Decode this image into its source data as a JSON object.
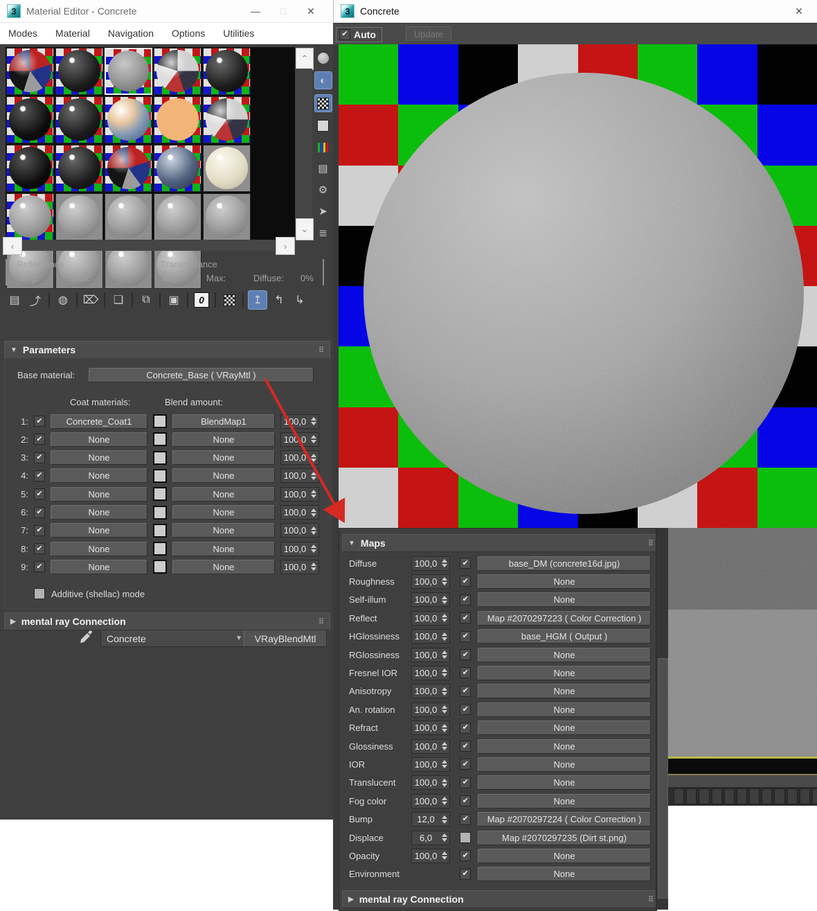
{
  "left_window": {
    "title": "Material Editor - Concrete",
    "window_buttons": {
      "minimize": "—",
      "maximize": "□",
      "close": "✕"
    },
    "menu": [
      "Modes",
      "Material",
      "Navigation",
      "Options",
      "Utilities"
    ],
    "slots": [
      {
        "bg": "checker",
        "ball": "multicolor",
        "selected": false
      },
      {
        "bg": "checker",
        "ball": "dark",
        "selected": false
      },
      {
        "bg": "checker",
        "ball": "concrete",
        "selected": true
      },
      {
        "bg": "checker",
        "ball": "reflective",
        "selected": false
      },
      {
        "bg": "checker",
        "ball": "dark",
        "selected": false
      },
      {
        "bg": "checker",
        "ball": "black",
        "selected": false
      },
      {
        "bg": "checker",
        "ball": "dark",
        "selected": false
      },
      {
        "bg": "checker",
        "ball": "glassy",
        "selected": false
      },
      {
        "bg": "checker",
        "ball": "orange",
        "selected": false
      },
      {
        "bg": "checker",
        "ball": "reflective",
        "selected": false
      },
      {
        "bg": "checker",
        "ball": "black",
        "selected": false
      },
      {
        "bg": "checker",
        "ball": "dark",
        "selected": false
      },
      {
        "bg": "checker",
        "ball": "multicolor",
        "selected": false
      },
      {
        "bg": "checker",
        "ball": "bluish",
        "selected": false
      },
      {
        "bg": "gray",
        "ball": "cream",
        "selected": false
      },
      {
        "bg": "checker",
        "ball": "gray",
        "selected": false
      },
      {
        "bg": "gray",
        "ball": "gray",
        "selected": false
      },
      {
        "bg": "gray",
        "ball": "gray",
        "selected": false
      },
      {
        "bg": "gray",
        "ball": "gray",
        "selected": false
      },
      {
        "bg": "gray",
        "ball": "gray",
        "selected": false
      },
      {
        "bg": "gray",
        "ball": "gray",
        "selected": false
      },
      {
        "bg": "gray",
        "ball": "gray",
        "selected": false
      },
      {
        "bg": "gray",
        "ball": "gray",
        "selected": false
      },
      {
        "bg": "gray",
        "ball": "gray",
        "selected": false
      }
    ],
    "side_toolbar": [
      {
        "name": "sample-type-icon",
        "type": "circle",
        "active": false
      },
      {
        "name": "backlight-icon",
        "type": "glyph",
        "glyph": "◐",
        "active": true
      },
      {
        "name": "background-icon",
        "type": "checker",
        "active": true
      },
      {
        "name": "sample-uv-tiling-icon",
        "type": "square",
        "active": false
      },
      {
        "name": "video-color-check-icon",
        "type": "bars",
        "active": false
      },
      {
        "name": "make-preview-icon",
        "type": "glyph",
        "glyph": "▤",
        "active": false
      },
      {
        "name": "options-icon",
        "type": "glyph",
        "glyph": "⚙",
        "active": false
      },
      {
        "name": "select-by-material-icon",
        "type": "glyph",
        "glyph": "➤",
        "active": false
      },
      {
        "name": "material-map-navigator-icon",
        "type": "glyph",
        "glyph": "≣",
        "active": false
      }
    ],
    "stats": {
      "reflectance": "Reflectance",
      "transmittance": "Transmittance",
      "avg": "Avg:",
      "max": "Max:",
      "diffuse_label": "Diffuse:",
      "diffuse_value": "0%"
    },
    "main_toolbar": [
      {
        "name": "get-material-icon",
        "type": "glyph",
        "glyph": "▤",
        "sep_after": false
      },
      {
        "name": "put-material-to-scene-icon",
        "type": "glyph",
        "glyph": "⤴",
        "sep_after": true
      },
      {
        "name": "assign-material-to-selection-icon",
        "type": "glyph",
        "glyph": "◍",
        "sep_after": true
      },
      {
        "name": "reset-map-mtl-icon",
        "type": "glyph",
        "glyph": "⌦",
        "sep_after": true
      },
      {
        "name": "make-material-copy-icon",
        "type": "glyph",
        "glyph": "❏",
        "sep_after": true
      },
      {
        "name": "make-unique-icon",
        "type": "glyph",
        "glyph": "⧉",
        "sep_after": true
      },
      {
        "name": "put-to-library-icon",
        "type": "glyph",
        "glyph": "▣",
        "sep_after": true
      },
      {
        "name": "material-id-channel-icon",
        "type": "zero",
        "glyph": "0",
        "sep_after": true
      },
      {
        "name": "show-shaded-material-icon",
        "type": "checker",
        "sep_after": true
      },
      {
        "name": "show-end-result-icon",
        "type": "glyph",
        "glyph": "↥",
        "active": true,
        "sep_after": false
      },
      {
        "name": "go-to-parent-icon",
        "type": "glyph",
        "glyph": "↰",
        "sep_after": false
      },
      {
        "name": "go-forward-to-sibling-icon",
        "type": "glyph",
        "glyph": "↳",
        "sep_after": false
      }
    ],
    "material_name": "Concrete",
    "material_type": "VRayBlendMtl",
    "parameters": {
      "title": "Parameters",
      "base_material_label": "Base material:",
      "base_material_value": "Concrete_Base  ( VRayMtl )",
      "coat_header": "Coat materials:",
      "blend_header": "Blend amount:",
      "rows": [
        {
          "index": "1:",
          "checked": true,
          "coat": "Concrete_Coat1",
          "blend": "BlendMap1",
          "amount": "100,0"
        },
        {
          "index": "2:",
          "checked": true,
          "coat": "None",
          "blend": "None",
          "amount": "100,0"
        },
        {
          "index": "3:",
          "checked": true,
          "coat": "None",
          "blend": "None",
          "amount": "100,0"
        },
        {
          "index": "4:",
          "checked": true,
          "coat": "None",
          "blend": "None",
          "amount": "100,0"
        },
        {
          "index": "5:",
          "checked": true,
          "coat": "None",
          "blend": "None",
          "amount": "100,0"
        },
        {
          "index": "6:",
          "checked": true,
          "coat": "None",
          "blend": "None",
          "amount": "100,0"
        },
        {
          "index": "7:",
          "checked": true,
          "coat": "None",
          "blend": "None",
          "amount": "100,0"
        },
        {
          "index": "8:",
          "checked": true,
          "coat": "None",
          "blend": "None",
          "amount": "100,0"
        },
        {
          "index": "9:",
          "checked": true,
          "coat": "None",
          "blend": "None",
          "amount": "100,0"
        }
      ],
      "additive_label": "Additive (shellac) mode",
      "additive_checked": false
    },
    "mental_ray_label": "mental ray Connection"
  },
  "preview_window": {
    "title": "Concrete",
    "close": "✕",
    "auto_label": "Auto",
    "auto_checked": true,
    "update_label": "Update",
    "checker": {
      "rows": 8,
      "cols": 8,
      "sequence_colors": [
        "#0cbe0c",
        "#c51414",
        "#d0d0d0",
        "#020202",
        "#0505e6"
      ],
      "sequence_names": [
        "green",
        "red",
        "lightgray",
        "black",
        "blue"
      ]
    }
  },
  "maps_panel": {
    "title": "Maps",
    "rows": [
      {
        "label": "Diffuse",
        "amount": "100,0",
        "checked": true,
        "map": "base_DM (concrete16d.jpg)"
      },
      {
        "label": "Roughness",
        "amount": "100,0",
        "checked": true,
        "map": "None"
      },
      {
        "label": "Self-illum",
        "amount": "100,0",
        "checked": true,
        "map": "None"
      },
      {
        "label": "Reflect",
        "amount": "100,0",
        "checked": true,
        "map": "Map #2070297223  ( Color Correction )"
      },
      {
        "label": "HGlossiness",
        "amount": "100,0",
        "checked": true,
        "map": "base_HGM  ( Output )"
      },
      {
        "label": "RGlossiness",
        "amount": "100,0",
        "checked": true,
        "map": "None"
      },
      {
        "label": "Fresnel IOR",
        "amount": "100,0",
        "checked": true,
        "map": "None"
      },
      {
        "label": "Anisotropy",
        "amount": "100,0",
        "checked": true,
        "map": "None"
      },
      {
        "label": "An. rotation",
        "amount": "100,0",
        "checked": true,
        "map": "None"
      },
      {
        "label": "Refract",
        "amount": "100,0",
        "checked": true,
        "map": "None"
      },
      {
        "label": "Glossiness",
        "amount": "100,0",
        "checked": true,
        "map": "None"
      },
      {
        "label": "IOR",
        "amount": "100,0",
        "checked": true,
        "map": "None"
      },
      {
        "label": "Translucent",
        "amount": "100,0",
        "checked": true,
        "map": "None"
      },
      {
        "label": "Fog color",
        "amount": "100,0",
        "checked": true,
        "map": "None"
      },
      {
        "label": "Bump",
        "amount": "12,0",
        "checked": true,
        "map": "Map #2070297224  ( Color Correction )"
      },
      {
        "label": "Displace",
        "amount": "6,0",
        "checked": false,
        "map": "Map #2070297235 (Dirt st.png)"
      },
      {
        "label": "Opacity",
        "amount": "100,0",
        "checked": true,
        "map": "None"
      },
      {
        "label": "Environment",
        "amount": null,
        "checked": true,
        "map": "None"
      }
    ],
    "mental_ray_label": "mental ray Connection"
  }
}
